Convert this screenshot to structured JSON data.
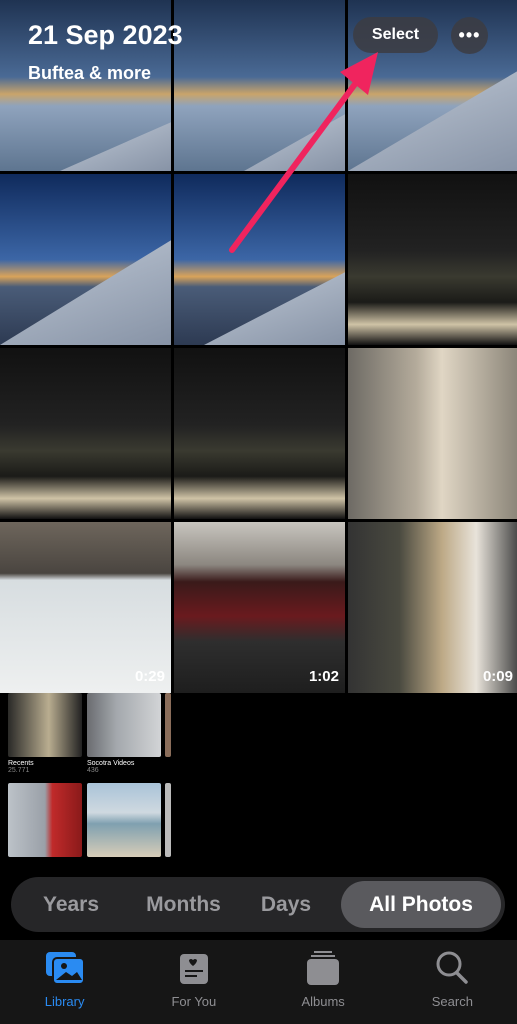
{
  "header": {
    "title": "21 Sep 2023",
    "subtitle": "Buftea & more",
    "select_label": "Select",
    "more_label": "•••"
  },
  "photos": [
    {
      "kind": "sky"
    },
    {
      "kind": "sky"
    },
    {
      "kind": "sky"
    },
    {
      "kind": "sky"
    },
    {
      "kind": "sky"
    },
    {
      "kind": "night"
    },
    {
      "kind": "night"
    },
    {
      "kind": "night"
    },
    {
      "kind": "drink"
    },
    {
      "kind": "video",
      "duration": "0:29"
    },
    {
      "kind": "video",
      "duration": "1:02"
    },
    {
      "kind": "video",
      "duration": "0:09"
    }
  ],
  "albums": [
    {
      "name": "Recents",
      "count": "25.771"
    },
    {
      "name": "Socotra Videos",
      "count": "436"
    }
  ],
  "annotation": {
    "arrow_color": "#f0245e",
    "target": "select-button"
  },
  "segments": {
    "items": [
      "Years",
      "Months",
      "Days",
      "All Photos"
    ],
    "selected": "All Photos"
  },
  "tabbar": {
    "items": [
      {
        "label": "Library",
        "icon": "photo-library-icon",
        "active": true
      },
      {
        "label": "For You",
        "icon": "for-you-icon"
      },
      {
        "label": "Albums",
        "icon": "albums-icon"
      },
      {
        "label": "Search",
        "icon": "search-icon"
      }
    ],
    "accent": "#2a8bf2"
  }
}
